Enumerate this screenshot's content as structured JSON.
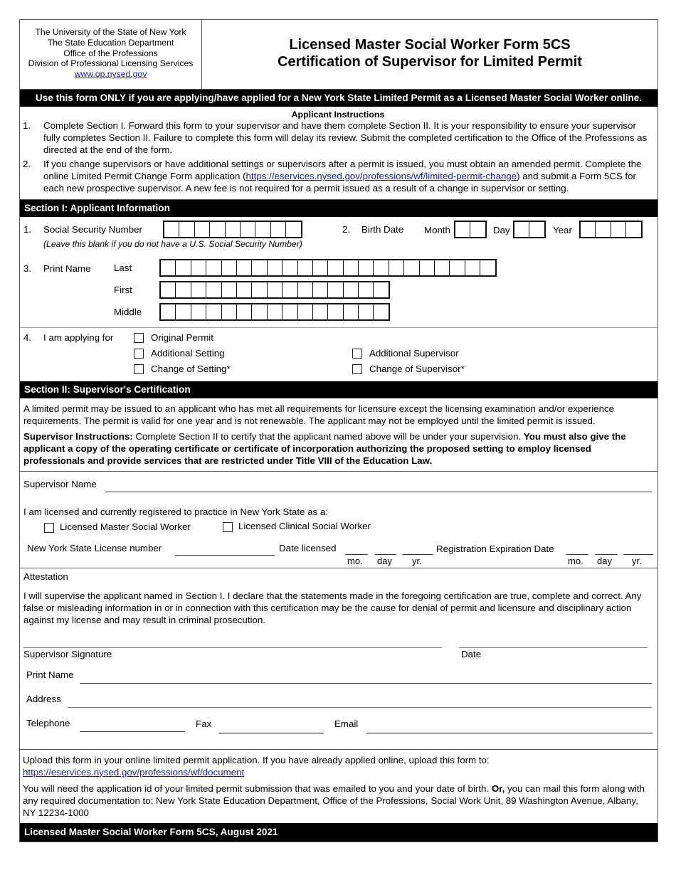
{
  "header": {
    "agency_lines": [
      "The University of the State of New York",
      "The State Education Department",
      "Office of the Professions",
      "Division of Professional Licensing Services"
    ],
    "agency_link": "www.op.nysed.gov",
    "title_line1": "Licensed Master Social Worker Form 5CS",
    "title_line2": "Certification of Supervisor for Limited Permit"
  },
  "notice_bar": "Use this form ONLY if you are applying/have applied for a New York State Limited Permit as a Licensed Master Social Worker online.",
  "applicant_instructions": {
    "title": "Applicant Instructions",
    "items": [
      {
        "num": "1.",
        "text": "Complete Section I. Forward this form to your supervisor and have them complete Section II. It is your responsibility to ensure your supervisor fully completes Section II. Failure to complete this form will delay its review. Submit the completed certification to the Office of the Professions as directed at the end of the form."
      },
      {
        "num": "2.",
        "text_before": "If you change supervisors or have additional settings or supervisors after a permit is issued, you must obtain an amended permit. Complete the online Limited Permit Change Form application (",
        "link": "https://eservices.nysed.gov/professions/wf/limited-permit-change",
        "text_after": ") and submit a Form 5CS for each new prospective supervisor. A new fee is not required for a permit issued as a result of a change in supervisor or setting."
      }
    ]
  },
  "section1": {
    "title": "Section I: Applicant Information",
    "ssn": {
      "num": "1.",
      "label": "Social Security Number",
      "note": "(Leave this blank if you do not have a U.S. Social Security Number)",
      "boxes": 9
    },
    "birth_date": {
      "num": "2.",
      "label": "Birth Date",
      "month_label": "Month",
      "day_label": "Day",
      "year_label": "Year",
      "month_boxes": 2,
      "day_boxes": 2,
      "year_boxes": 4
    },
    "print_name": {
      "num": "3.",
      "label": "Print Name",
      "last_label": "Last",
      "last_boxes": 22,
      "first_label": "First",
      "first_boxes": 15,
      "middle_label": "Middle",
      "middle_boxes": 15
    },
    "applying_for": {
      "num": "4.",
      "label": "I am applying for",
      "options": [
        {
          "label": "Original Permit",
          "checked": false
        },
        {
          "label": "Additional Setting",
          "checked": false
        },
        {
          "label": "Change of Setting*",
          "checked": false
        },
        {
          "label": "Additional Supervisor",
          "checked": false
        },
        {
          "label": "Change of Supervisor*",
          "checked": false
        }
      ]
    }
  },
  "section2": {
    "title": "Section II: Supervisor's Certification",
    "intro": "A limited permit may be issued to an applicant who has met all requirements for licensure except the licensing examination and/or experience requirements. The permit is valid for one year and is not renewable. The applicant may not be employed until the limited permit is issued.",
    "instructions_label": "Supervisor Instructions:",
    "instructions_text": " Complete Section II to certify that the applicant named above will be under your supervision. ",
    "instructions_bold": "You must also give the applicant a copy of the operating certificate or certificate of incorporation authorizing the proposed setting to employ licensed professionals and provide services that are restricted under Title VIII of the Education Law.",
    "supervisor_name_label": "Supervisor Name",
    "licensed_as_label": "I am licensed and currently registered to practice in New York State as a:",
    "license_types": [
      {
        "label": "Licensed Master Social Worker",
        "checked": false
      },
      {
        "label": "Licensed Clinical Social Worker",
        "checked": false
      }
    ],
    "license_number_label": "New York State License number",
    "date_licensed_label": "Date licensed",
    "reg_exp_label": "Registration Expiration Date",
    "date_parts": {
      "mo": "mo.",
      "day": "day",
      "yr": "yr."
    },
    "attestation_title": "Attestation",
    "attestation_text": "I will supervise the applicant named in Section I. I declare that the statements made in the foregoing certification are true, complete and correct. Any false or misleading information in or in connection with this certification may be the cause for denial of permit and licensure and disciplinary action against my license and may result in criminal prosecution.",
    "signature_label": "Supervisor Signature",
    "date_label": "Date",
    "print_name_label": "Print Name",
    "address_label": "Address",
    "telephone_label": "Telephone",
    "fax_label": "Fax",
    "email_label": "Email"
  },
  "footer": {
    "upload_text": "Upload this form in your online limited permit application. If you have already applied online, upload this form to:",
    "upload_link": "https://eservices.nysed.gov/professions/wf/document",
    "mail_text_before": "You will need the application id of your limited permit submission that was emailed to you and your date of birth. ",
    "mail_or": "Or,",
    "mail_text_after": " you can mail this form along with any required documentation to: New York State Education Department, Office of the Professions, Social Work Unit, 89 Washington Avenue, Albany, NY 12234-1000",
    "form_id_bar": "Licensed Master Social Worker Form 5CS, August 2021"
  }
}
